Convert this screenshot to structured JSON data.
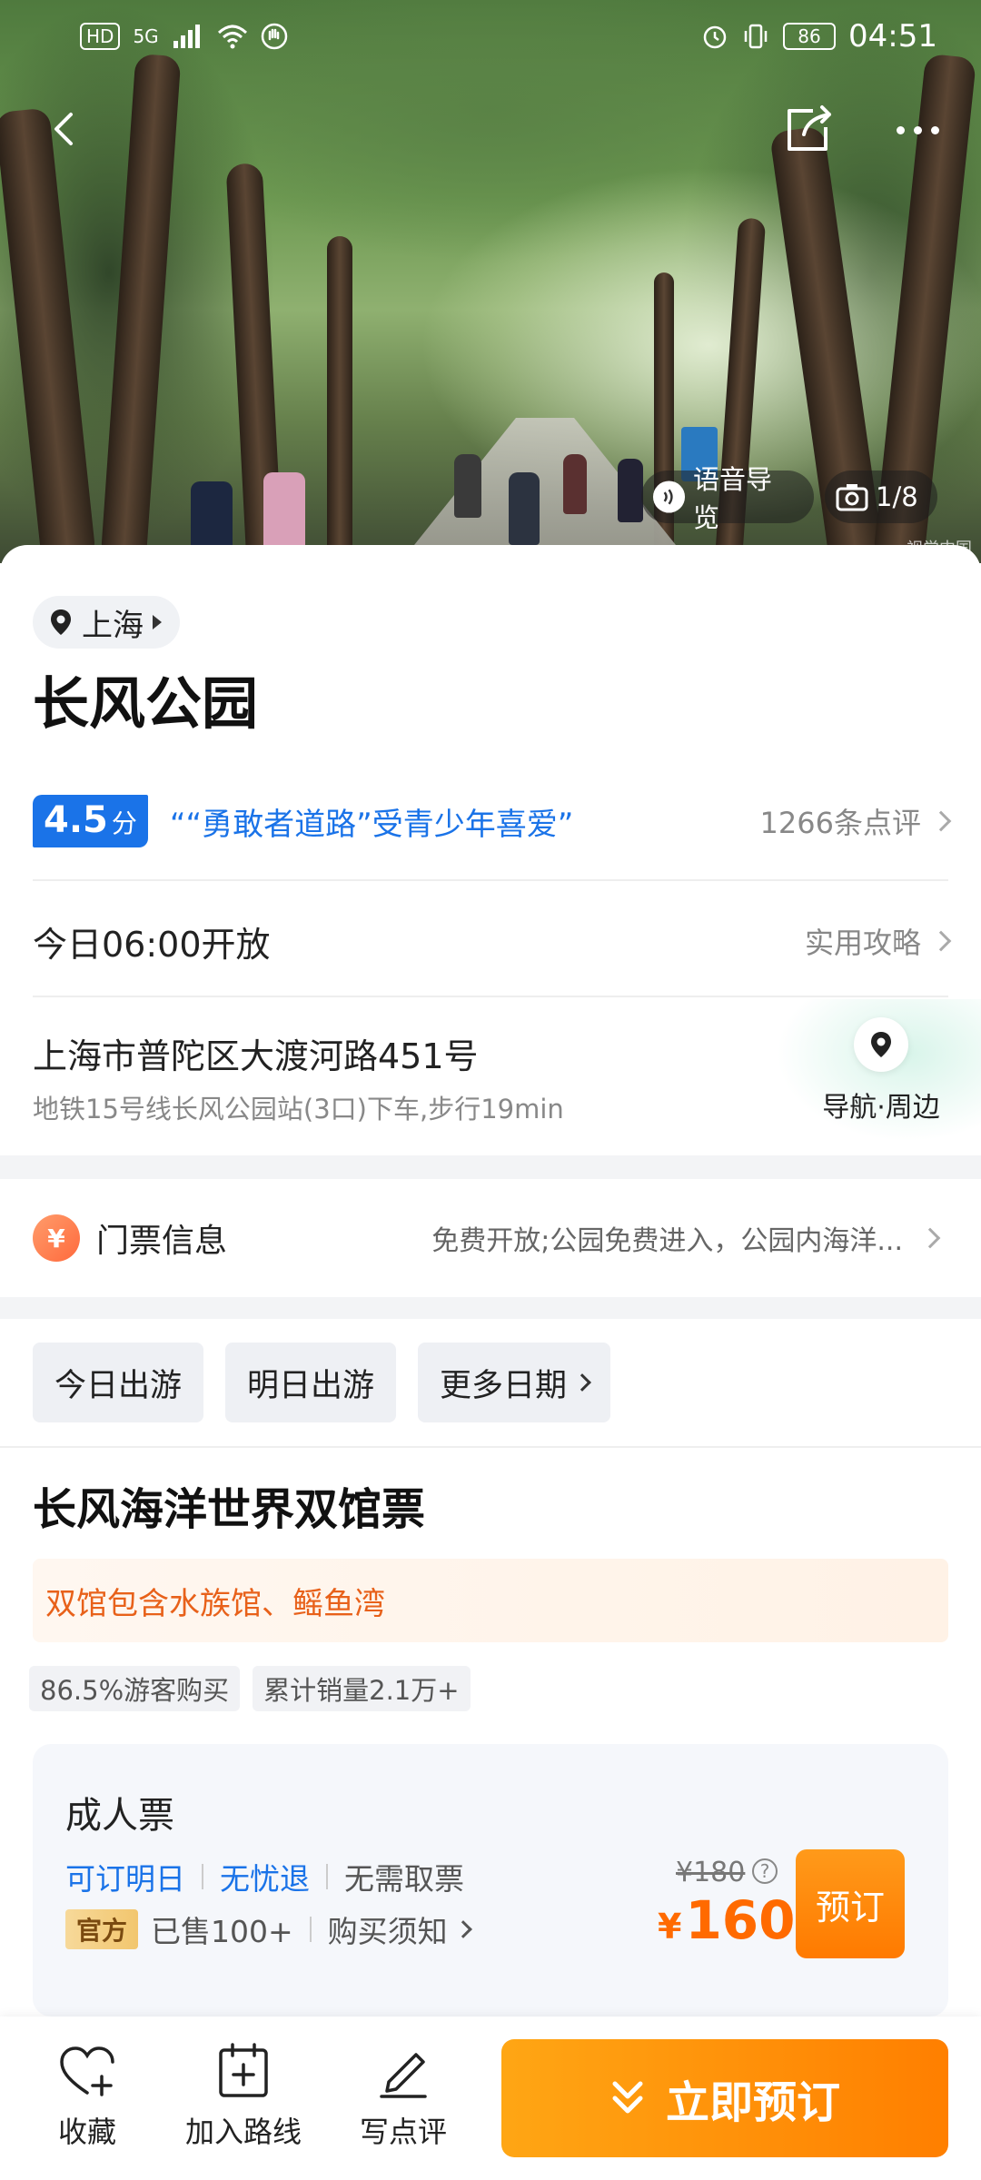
{
  "status_bar": {
    "left_chips": [
      "HD",
      "5G"
    ],
    "battery": "86",
    "time": "04:51"
  },
  "hero": {
    "audio_guide_label": "语音导览",
    "photo_counter": "1/8",
    "photo_credit": "视觉中国"
  },
  "location": {
    "city": "上海",
    "name": "长风公园"
  },
  "rating": {
    "score": "4.5",
    "unit": "分",
    "highlight": "““勇敢者道路”受青少年喜爱”",
    "review_count": "1266条点评"
  },
  "hours": {
    "text": "今日06:00开放",
    "guide_link": "实用攻略"
  },
  "address": {
    "main": "上海市普陀区大渡河路451号",
    "transit": "地铁15号线长风公园站(3口)下车,步行19min",
    "nav_label": "导航·周边"
  },
  "ticket_info": {
    "icon_char": "¥",
    "label": "门票信息",
    "desc": "免费开放;公园免费进入，公园内海洋..."
  },
  "date_options": [
    "今日出游",
    "明日出游",
    "更多日期"
  ],
  "product": {
    "title": "长风海洋世界双馆票",
    "promo": "双馆包含水族馆、鳐鱼湾",
    "stats": [
      "86.5%游客购买",
      "累计销量2.1万+"
    ]
  },
  "ticket_card": {
    "name": "成人票",
    "tags": [
      "可订明日",
      "无忧退",
      "无需取票"
    ],
    "official_badge": "官方",
    "sold": "已售100+",
    "notice": "购买须知",
    "original_price": "¥180",
    "price_symbol": "¥",
    "price": "160",
    "book_label": "预订"
  },
  "bottom_bar": {
    "favorite": "收藏",
    "add_route": "加入路线",
    "write_review": "写点评",
    "cta": "立即预订"
  },
  "colors": {
    "accent_blue": "#1a73e8",
    "accent_orange": "#ff7f00"
  }
}
